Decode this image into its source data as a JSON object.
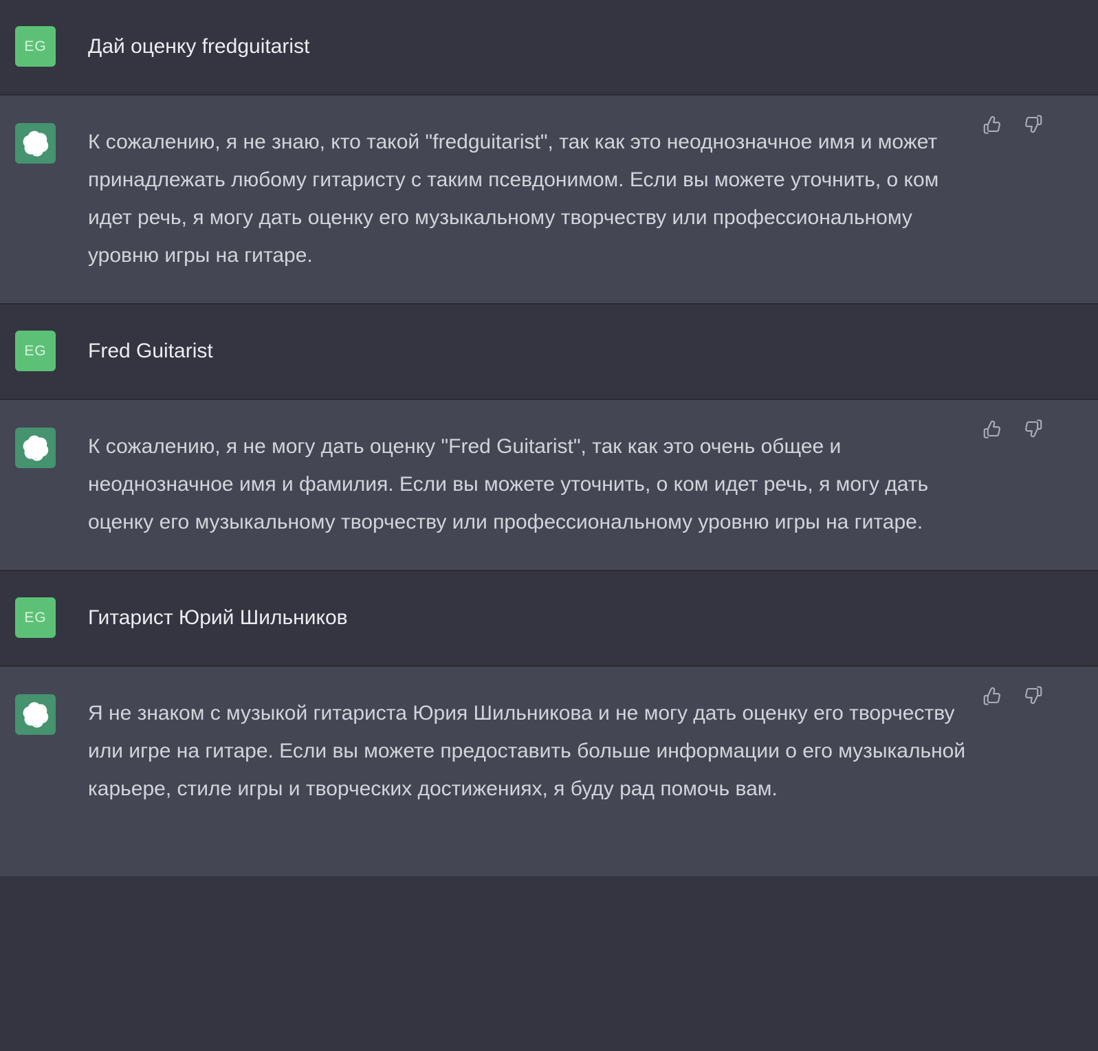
{
  "theme": {
    "user_row_bg": "#343541",
    "assistant_row_bg": "#444654",
    "divider": "#2a2b32",
    "user_avatar_bg": "#5cc176",
    "assistant_avatar_bg": "#45936f",
    "user_text_color": "#ececf1",
    "assistant_text_color": "#d1d5db",
    "icon_color": "#a9acbb"
  },
  "avatars": {
    "user_initials": "EG",
    "user_icon_name": "user-initials-avatar",
    "assistant_icon_name": "openai-logo-icon"
  },
  "actions": {
    "thumbs_up_label": "Хорошо",
    "thumbs_down_label": "Плохо",
    "thumbs_up_icon": "thumbs-up-icon",
    "thumbs_down_icon": "thumbs-down-icon"
  },
  "conversation": {
    "messages": [
      {
        "role": "user",
        "text": "Дай оценку fredguitarist"
      },
      {
        "role": "assistant",
        "text": "К сожалению, я не знаю, кто такой \"fredguitarist\", так как это неоднозначное имя и может принадлежать любому гитаристу с таким псевдонимом. Если вы можете уточнить, о ком идет речь, я могу дать оценку его музыкальному творчеству или профессиональному уровню игры на гитаре."
      },
      {
        "role": "user",
        "text": "Fred Guitarist"
      },
      {
        "role": "assistant",
        "text": "К сожалению, я не могу дать оценку \"Fred Guitarist\", так как это очень общее и неоднозначное имя и фамилия. Если вы можете уточнить, о ком идет речь, я могу дать оценку его музыкальному творчеству или профессиональному уровню игры на гитаре."
      },
      {
        "role": "user",
        "text": "Гитарист Юрий Шильников"
      },
      {
        "role": "assistant",
        "text": "Я не знаком с музыкой гитариста Юрия Шильникова и не могу дать оценку его творчеству или игре на гитаре. Если вы можете предоставить больше информации о его музыкальной карьере, стиле игры и творческих достижениях, я буду рад помочь вам."
      }
    ]
  }
}
